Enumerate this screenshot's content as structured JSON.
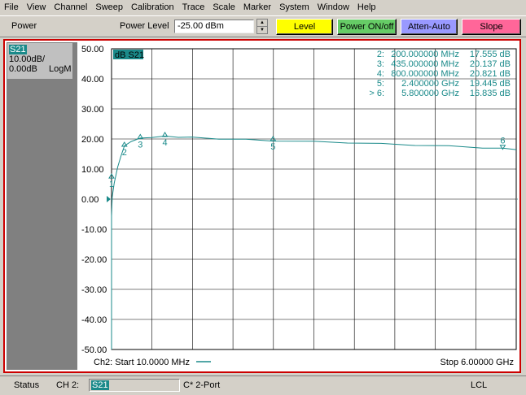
{
  "menu": [
    "File",
    "View",
    "Channel",
    "Sweep",
    "Calibration",
    "Trace",
    "Scale",
    "Marker",
    "System",
    "Window",
    "Help"
  ],
  "toolbar": {
    "title": "Power",
    "power_level_label": "Power Level",
    "power_level_value": "-25.00 dBm",
    "buttons": [
      {
        "label": "Level",
        "color": "#ffff00"
      },
      {
        "label": "Power ON/off",
        "color": "#66cc66"
      },
      {
        "label": "Atten-Auto",
        "color": "#9999ff"
      },
      {
        "label": "Slope",
        "color": "#ff6699"
      }
    ]
  },
  "trace_info": {
    "tag": "S21",
    "scale": "10.00dB/",
    "ref": "0.00dB",
    "format": "LogM",
    "trace_label": "dB S21",
    "color": "#1a8a8a"
  },
  "chart_data": {
    "type": "line",
    "ylim": [
      -50,
      50
    ],
    "yticks": [
      "50.00",
      "40.00",
      "30.00",
      "20.00",
      "10.00",
      "0.00",
      "-10.00",
      "-20.00",
      "-30.00",
      "-40.00",
      "-50.00"
    ],
    "x_start_label": "Ch2: Start  10.0000 MHz",
    "x_stop_label": "Stop  6.00000 GHz",
    "xlim_ghz": [
      0.01,
      6.0
    ],
    "series": [
      {
        "x_ghz": [
          0.01,
          0.02,
          0.05,
          0.1,
          0.15,
          0.2,
          0.3,
          0.435,
          0.6,
          0.8,
          1.0,
          1.2,
          1.6,
          2.0,
          2.4,
          3.0,
          3.5,
          4.0,
          4.5,
          5.0,
          5.5,
          5.8,
          6.0
        ],
        "y_db": [
          -5.5,
          0.5,
          5.5,
          10.5,
          14.5,
          17.555,
          19.3,
          20.137,
          20.6,
          20.821,
          20.7,
          20.5,
          20.1,
          19.8,
          19.445,
          19.1,
          18.8,
          18.4,
          18.0,
          17.6,
          17.1,
          16.835,
          16.6
        ]
      }
    ],
    "markers": [
      {
        "id": "1",
        "x_ghz": 0.01,
        "y_db": 7.0
      },
      {
        "id": "2",
        "x_ghz": 0.2,
        "y_db": 17.555
      },
      {
        "id": "3",
        "x_ghz": 0.435,
        "y_db": 20.137
      },
      {
        "id": "4",
        "x_ghz": 0.8,
        "y_db": 20.821
      },
      {
        "id": "5",
        "x_ghz": 2.4,
        "y_db": 19.445
      },
      {
        "id": "6",
        "x_ghz": 5.8,
        "y_db": 16.835
      }
    ],
    "marker_table": [
      {
        "label": "2:",
        "freq": "200.000000 MHz",
        "value": "17.555 dB"
      },
      {
        "label": "3:",
        "freq": "435.000000 MHz",
        "value": "20.137 dB"
      },
      {
        "label": "4:",
        "freq": "800.000000 MHz",
        "value": "20.821 dB"
      },
      {
        "label": "5:",
        "freq": "2.400000 GHz",
        "value": "19.445 dB"
      },
      {
        "label": "> 6:",
        "freq": "5.800000 GHz",
        "value": "16.835 dB"
      }
    ]
  },
  "statusbar": {
    "status": "Status",
    "channel": "CH 2:",
    "trace": "S21",
    "cal": "C* 2-Port",
    "mode": "LCL"
  }
}
